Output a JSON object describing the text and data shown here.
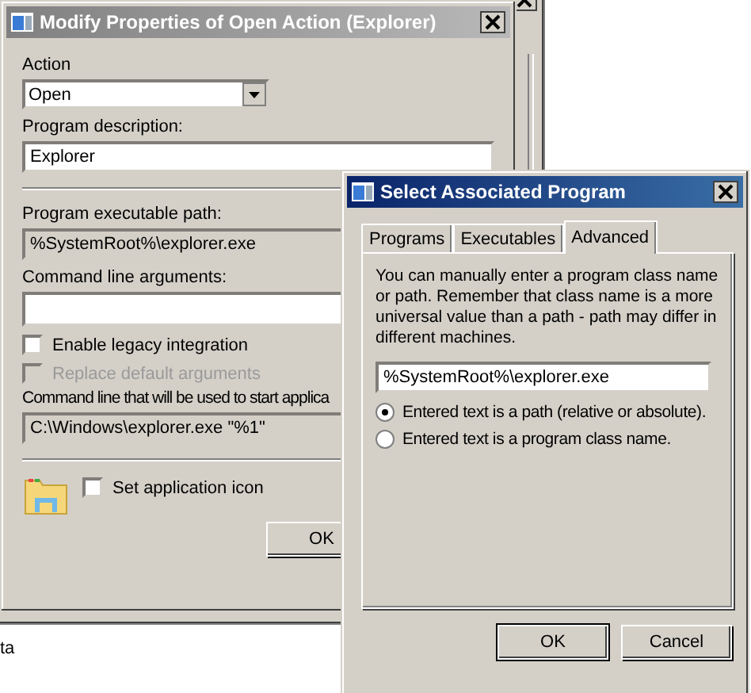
{
  "main_dialog": {
    "title": "Modify Properties of Open Action (Explorer)",
    "active": false,
    "action_label": "Action",
    "action_value": "Open",
    "description_label": "Program description:",
    "description_value": "Explorer",
    "path_label": "Program executable path:",
    "path_value": "%SystemRoot%\\explorer.exe",
    "arguments_label": "Command line arguments:",
    "checkboxes": [
      {
        "label": "Enable legacy integration",
        "checked": false,
        "disabled": false
      },
      {
        "label": "Replace default arguments",
        "checked": false,
        "disabled": true
      }
    ],
    "command_label": "Command line that will be used to start applica",
    "command_value": "C:\\Windows\\explorer.exe \"%1\"",
    "icon_checkbox": {
      "label": "Set application icon",
      "checked": false
    },
    "buttons": [
      "OK"
    ]
  },
  "front_dialog": {
    "title": "Select Associated Program",
    "active": true,
    "tabs": [
      {
        "label": "Programs",
        "selected": false
      },
      {
        "label": "Executables",
        "selected": false
      },
      {
        "label": "Advanced",
        "selected": true
      }
    ],
    "description": "You can manually enter a program class name or path. Remember that class name is a more universal value than a path - path may differ in different machines.",
    "path_value": "%SystemRoot%\\explorer.exe",
    "options": [
      {
        "label": "Entered text is a path (relative or absolute).",
        "selected": true
      },
      {
        "label": "Entered text is a program class name.",
        "selected": false
      }
    ],
    "buttons": [
      "OK",
      "Cancel"
    ]
  },
  "background_text": "ta"
}
